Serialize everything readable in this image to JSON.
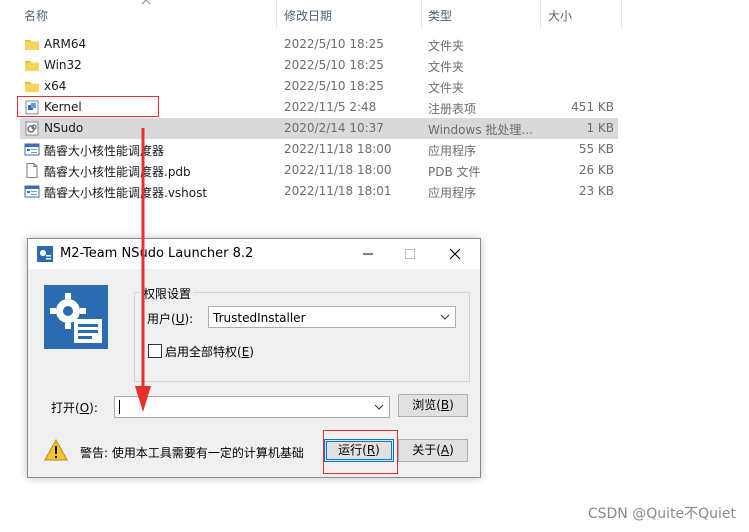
{
  "columns": {
    "name": "名称",
    "modified": "修改日期",
    "type": "类型",
    "size": "大小"
  },
  "files": [
    {
      "name": "ARM64",
      "date": "2022/5/10 18:25",
      "type": "文件夹",
      "size": "",
      "icon": "folder-icon"
    },
    {
      "name": "Win32",
      "date": "2022/5/10 18:25",
      "type": "文件夹",
      "size": "",
      "icon": "folder-icon"
    },
    {
      "name": "x64",
      "date": "2022/5/10 18:25",
      "type": "文件夹",
      "size": "",
      "icon": "folder-icon"
    },
    {
      "name": "Kernel",
      "date": "2022/11/5 2:48",
      "type": "注册表项",
      "size": "451 KB",
      "icon": "registry-icon"
    },
    {
      "name": "NSudo",
      "date": "2020/2/14 10:37",
      "type": "Windows 批处理...",
      "size": "1 KB",
      "icon": "batch-icon"
    },
    {
      "name": "酷睿大小核性能调度器",
      "date": "2022/11/18 18:00",
      "type": "应用程序",
      "size": "55 KB",
      "icon": "app-icon"
    },
    {
      "name": "酷睿大小核性能调度器.pdb",
      "date": "2022/11/18 18:00",
      "type": "PDB 文件",
      "size": "26 KB",
      "icon": "file-icon"
    },
    {
      "name": "酷睿大小核性能调度器.vshost",
      "date": "2022/11/18 18:01",
      "type": "应用程序",
      "size": "23 KB",
      "icon": "app-icon"
    }
  ],
  "dialog": {
    "title": "M2-Team NSudo Launcher 8.2",
    "group_label": "权限设置",
    "user_label": "用户(",
    "user_key": "U",
    "user_label_end": "):",
    "user_value": "TrustedInstaller",
    "all_priv_label": "启用全部特权(",
    "all_priv_key": "E",
    "all_priv_end": ")",
    "open_label": "打开(",
    "open_key": "O",
    "open_end": "):",
    "open_value": "",
    "browse_label": "浏览(",
    "browse_key": "B",
    "browse_end": ")",
    "warning_text": "警告: 使用本工具需要有一定的计算机基础",
    "run_label": "运行(",
    "run_key": "R",
    "run_end": ")",
    "about_label": "关于(",
    "about_key": "A",
    "about_end": ")"
  },
  "watermark": "CSDN @Quite不Quiet",
  "colors": {
    "accent": "#0078d7",
    "highlight_box": "#e03030",
    "arrow": "#e8302a",
    "selection": "#d9d9d9"
  }
}
